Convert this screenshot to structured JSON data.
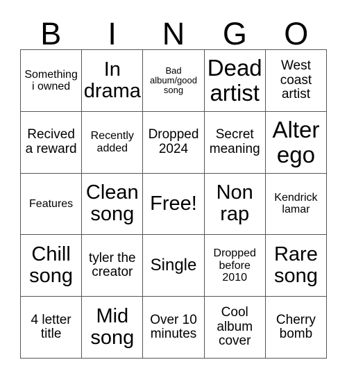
{
  "card": {
    "title": "BINGO",
    "header_letters": [
      "B",
      "I",
      "N",
      "G",
      "O"
    ],
    "free_space_label": "Free!",
    "colors": {
      "background": "#ffffff",
      "cell_background": "#ffffff",
      "border": "#555555",
      "text": "#000000"
    },
    "grid": {
      "columns": 5,
      "rows": 5,
      "cells": [
        [
          {
            "label": "Something i owned",
            "size": "s"
          },
          {
            "label": "In drama",
            "size": "xl"
          },
          {
            "label": "Bad album/good song",
            "size": "xs"
          },
          {
            "label": "Dead artist",
            "size": "xxl"
          },
          {
            "label": "West coast artist",
            "size": "m"
          }
        ],
        [
          {
            "label": "Recived a reward",
            "size": "m"
          },
          {
            "label": "Recently added",
            "size": "s"
          },
          {
            "label": "Dropped 2024",
            "size": "m"
          },
          {
            "label": "Secret meaning",
            "size": "m"
          },
          {
            "label": "Alter ego",
            "size": "xxl"
          }
        ],
        [
          {
            "label": "Features",
            "size": "s"
          },
          {
            "label": "Clean song",
            "size": "xl"
          },
          {
            "label": "Free!",
            "size": "xl"
          },
          {
            "label": "Non rap",
            "size": "xl"
          },
          {
            "label": "Kendrick lamar",
            "size": "s"
          }
        ],
        [
          {
            "label": "Chill song",
            "size": "xl"
          },
          {
            "label": "tyler the creator",
            "size": "m"
          },
          {
            "label": "Single",
            "size": "l"
          },
          {
            "label": "Dropped before 2010",
            "size": "s"
          },
          {
            "label": "Rare song",
            "size": "xl"
          }
        ],
        [
          {
            "label": "4 letter title",
            "size": "m"
          },
          {
            "label": "Mid song",
            "size": "xl"
          },
          {
            "label": "Over 10 minutes",
            "size": "m"
          },
          {
            "label": "Cool album cover",
            "size": "m"
          },
          {
            "label": "Cherry bomb",
            "size": "m"
          }
        ]
      ]
    }
  }
}
